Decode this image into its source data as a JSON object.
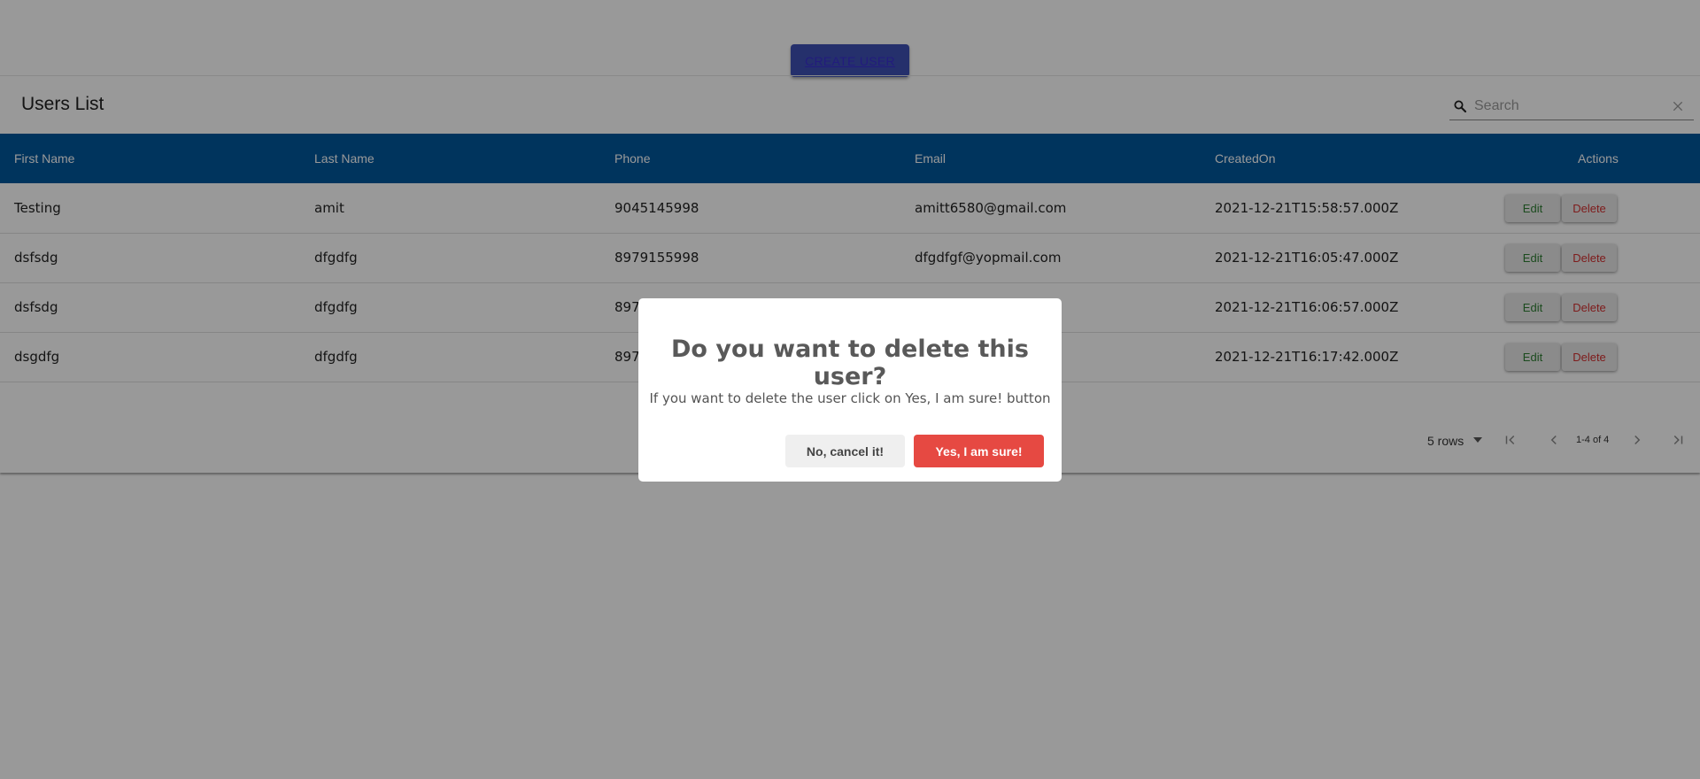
{
  "create_button": {
    "label": "CREATE USER"
  },
  "table": {
    "title": "Users List",
    "search_placeholder": "Search",
    "columns": [
      "First Name",
      "Last Name",
      "Phone",
      "Email",
      "CreatedOn",
      "Actions"
    ],
    "rows": [
      [
        "Testing",
        "amit",
        "9045145998",
        "amitt6580@gmail.com",
        "2021-12-21T15:58:57.000Z"
      ],
      [
        "dsfsdg",
        "dfgdfg",
        "8979155998",
        "dfgdfgf@yopmail.com",
        "2021-12-21T16:05:47.000Z"
      ],
      [
        "dsfsdg",
        "dfgdfg",
        "897",
        "",
        "2021-12-21T16:06:57.000Z"
      ],
      [
        "dsgdfg",
        "dfgdfg",
        "897",
        "",
        "2021-12-21T16:17:42.000Z"
      ]
    ],
    "edit_label": "Edit",
    "delete_label": "Delete"
  },
  "pagination": {
    "rows_per_page": "5 rows",
    "range": "1-4 of 4"
  },
  "dialog": {
    "title": "Do you want to delete this user?",
    "text": "If you want to delete the user click on Yes, I am sure! button",
    "cancel_label": "No, cancel it!",
    "confirm_label": "Yes, I am sure!"
  },
  "colors": {
    "header_bg": "#01579b",
    "create_button_bg": "#3f51b5",
    "confirm_bg": "#e64942",
    "edit_text": "#2e7d32",
    "delete_text": "#d32f2f"
  }
}
